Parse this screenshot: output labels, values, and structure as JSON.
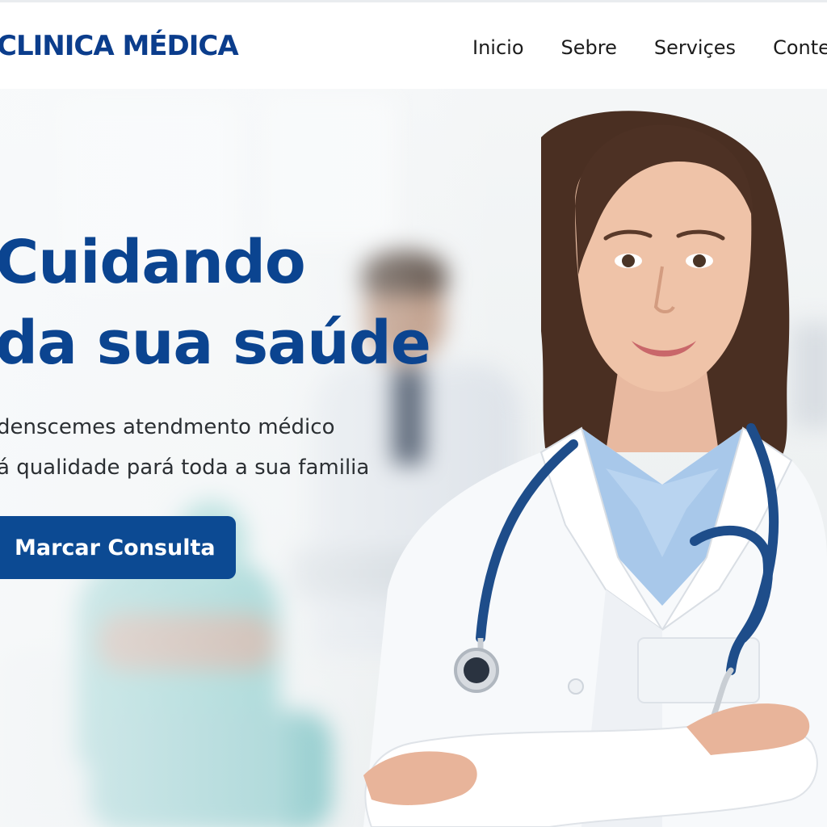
{
  "header": {
    "logo": "CLINICA MÉDICA",
    "nav": [
      "Inicio",
      "Sebre",
      "Serviçes",
      "Conte"
    ]
  },
  "hero": {
    "title_line1": "Cuidando",
    "title_line2": "da sua saúde",
    "subtitle_line1": "denscemes atendmento médico",
    "subtitle_line2": "á qualidade pará toda a sua familia",
    "cta_label": "Marcar Consulta"
  },
  "colors": {
    "brand_blue": "#0b4490",
    "button_blue": "#0c4a93",
    "scrub_teal": "#2aa3a0"
  },
  "icons": [
    "stethoscope"
  ]
}
